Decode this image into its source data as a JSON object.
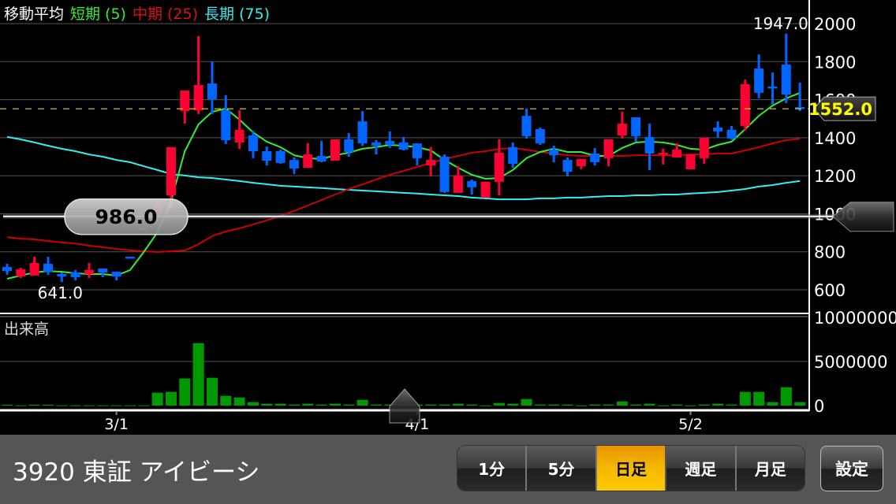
{
  "legend": {
    "title": "移動平均",
    "short": "短期 (5)",
    "mid": "中期 (25)",
    "long": "長期 (75)"
  },
  "colors": {
    "up": "#ff0033",
    "down": "#0066ff",
    "ma_short": "#33ee33",
    "ma_mid": "#cc0000",
    "ma_long": "#33eeee",
    "volume": "#009900",
    "current_price": "#ffff00"
  },
  "volume_title": "出来高",
  "price_axis": {
    "min": 600,
    "max": 2000,
    "ticks": [
      "2000",
      "1800",
      "1600",
      "1400",
      "1200",
      "1000",
      "800",
      "600"
    ]
  },
  "volume_axis": {
    "max": 10000000,
    "ticks": [
      "10000000",
      "5000000",
      "0"
    ]
  },
  "annotations": {
    "high_label": "1947.0",
    "low_label": "641.0",
    "current_price": "1552.0",
    "crosshair_price": "986.0"
  },
  "annotation_values": {
    "high": 1947,
    "high_index": 57,
    "low": 641,
    "low_index": 4,
    "current": 1552,
    "crosshair": 986
  },
  "date_labels": [
    {
      "text": "3/1",
      "index": 8
    },
    {
      "text": "4/1",
      "index": 30
    },
    {
      "text": "5/2",
      "index": 50
    }
  ],
  "chart_data": {
    "type": "candlestick",
    "ohlc": [
      [
        720,
        737,
        679,
        699
      ],
      [
        670,
        716,
        662,
        708
      ],
      [
        675,
        774,
        675,
        741
      ],
      [
        737,
        774,
        679,
        695
      ],
      [
        683,
        691,
        641,
        670
      ],
      [
        691,
        704,
        650,
        666
      ],
      [
        683,
        741,
        662,
        704
      ],
      [
        712,
        712,
        666,
        691
      ],
      [
        695,
        695,
        650,
        670
      ],
      [
        774,
        774,
        774,
        774
      ],
      [
        923,
        923,
        923,
        923
      ],
      [
        994,
        1068,
        956,
        1047
      ],
      [
        1097,
        1350,
        1018,
        1350
      ],
      [
        1540,
        1648,
        1474,
        1648
      ],
      [
        1544,
        1934,
        1524,
        1677
      ],
      [
        1685,
        1801,
        1524,
        1602
      ],
      [
        1544,
        1623,
        1366,
        1387
      ],
      [
        1375,
        1544,
        1341,
        1441
      ],
      [
        1412,
        1437,
        1292,
        1329
      ],
      [
        1329,
        1354,
        1254,
        1279
      ],
      [
        1329,
        1337,
        1263,
        1267
      ],
      [
        1283,
        1296,
        1209,
        1238
      ],
      [
        1242,
        1371,
        1242,
        1312
      ],
      [
        1304,
        1383,
        1271,
        1275
      ],
      [
        1279,
        1391,
        1279,
        1391
      ],
      [
        1391,
        1424,
        1300,
        1325
      ],
      [
        1486,
        1540,
        1358,
        1370
      ],
      [
        1375,
        1387,
        1312,
        1358
      ],
      [
        1383,
        1433,
        1346,
        1362
      ],
      [
        1375,
        1404,
        1333,
        1337
      ],
      [
        1370,
        1370,
        1254,
        1292
      ],
      [
        1254,
        1350,
        1196,
        1283
      ],
      [
        1300,
        1312,
        1110,
        1114
      ],
      [
        1110,
        1250,
        1110,
        1201
      ],
      [
        1172,
        1180,
        1101,
        1139
      ],
      [
        1085,
        1168,
        1085,
        1168
      ],
      [
        1168,
        1391,
        1097,
        1321
      ],
      [
        1350,
        1375,
        1242,
        1263
      ],
      [
        1515,
        1553,
        1395,
        1408
      ],
      [
        1445,
        1453,
        1362,
        1370
      ],
      [
        1337,
        1358,
        1271,
        1308
      ],
      [
        1283,
        1296,
        1196,
        1221
      ],
      [
        1250,
        1288,
        1234,
        1288
      ],
      [
        1317,
        1346,
        1254,
        1271
      ],
      [
        1292,
        1391,
        1250,
        1391
      ],
      [
        1412,
        1536,
        1395,
        1474
      ],
      [
        1507,
        1507,
        1379,
        1408
      ],
      [
        1404,
        1474,
        1230,
        1317
      ],
      [
        1312,
        1342,
        1259,
        1321
      ],
      [
        1296,
        1371,
        1296,
        1337
      ],
      [
        1234,
        1313,
        1234,
        1313
      ],
      [
        1292,
        1400,
        1263,
        1400
      ],
      [
        1453,
        1486,
        1400,
        1433
      ],
      [
        1441,
        1462,
        1390,
        1396
      ],
      [
        1462,
        1706,
        1437,
        1681
      ],
      [
        1764,
        1838,
        1607,
        1636
      ],
      [
        1669,
        1743,
        1574,
        1661
      ],
      [
        1785,
        1947,
        1582,
        1627
      ],
      [
        1561,
        1690,
        1540,
        1552
      ]
    ],
    "ma_short": [
      658,
      675,
      691,
      699,
      695,
      687,
      683,
      683,
      675,
      704,
      799,
      902,
      1068,
      1329,
      1470,
      1536,
      1553,
      1495,
      1428,
      1379,
      1350,
      1308,
      1292,
      1288,
      1308,
      1321,
      1342,
      1350,
      1362,
      1358,
      1350,
      1333,
      1283,
      1242,
      1205,
      1184,
      1188,
      1230,
      1292,
      1325,
      1342,
      1325,
      1325,
      1304,
      1304,
      1346,
      1375,
      1379,
      1375,
      1362,
      1342,
      1337,
      1362,
      1379,
      1445,
      1515,
      1569,
      1607,
      1636
    ],
    "ma_mid": [
      877,
      869,
      865,
      857,
      849,
      844,
      832,
      824,
      815,
      807,
      803,
      799,
      803,
      807,
      840,
      882,
      907,
      923,
      944,
      965,
      989,
      1014,
      1043,
      1072,
      1101,
      1130,
      1155,
      1180,
      1205,
      1225,
      1246,
      1267,
      1288,
      1304,
      1321,
      1329,
      1341,
      1346,
      1337,
      1325,
      1317,
      1308,
      1304,
      1304,
      1304,
      1304,
      1308,
      1308,
      1308,
      1308,
      1312,
      1312,
      1317,
      1317,
      1333,
      1350,
      1370,
      1387,
      1395
    ],
    "ma_long": [
      1404,
      1391,
      1375,
      1358,
      1342,
      1329,
      1312,
      1300,
      1283,
      1271,
      1250,
      1230,
      1209,
      1201,
      1192,
      1188,
      1180,
      1172,
      1163,
      1155,
      1147,
      1143,
      1139,
      1135,
      1130,
      1126,
      1122,
      1118,
      1114,
      1110,
      1106,
      1101,
      1097,
      1093,
      1085,
      1081,
      1076,
      1076,
      1076,
      1081,
      1081,
      1085,
      1085,
      1089,
      1093,
      1093,
      1097,
      1097,
      1101,
      1101,
      1106,
      1110,
      1114,
      1122,
      1130,
      1143,
      1151,
      1163,
      1172
    ],
    "volume": [
      100000,
      30000,
      100000,
      100000,
      30000,
      30000,
      30000,
      30000,
      30000,
      30000,
      30000,
      1460000,
      1550000,
      3070000,
      7080000,
      3150000,
      1100000,
      920000,
      390000,
      210000,
      210000,
      120000,
      210000,
      120000,
      210000,
      120000,
      650000,
      120000,
      120000,
      120000,
      120000,
      120000,
      120000,
      210000,
      120000,
      20000,
      300000,
      210000,
      740000,
      120000,
      120000,
      120000,
      20000,
      120000,
      120000,
      470000,
      120000,
      210000,
      20000,
      120000,
      20000,
      120000,
      210000,
      120000,
      1550000,
      1550000,
      390000,
      2080000,
      390000
    ]
  },
  "bottom": {
    "stock_name": "3920 東証 アイビーシ",
    "periods": [
      {
        "label": "1分",
        "active": false
      },
      {
        "label": "5分",
        "active": false
      },
      {
        "label": "日足",
        "active": true
      },
      {
        "label": "週足",
        "active": false
      },
      {
        "label": "月足",
        "active": false
      }
    ],
    "settings_label": "設定"
  }
}
